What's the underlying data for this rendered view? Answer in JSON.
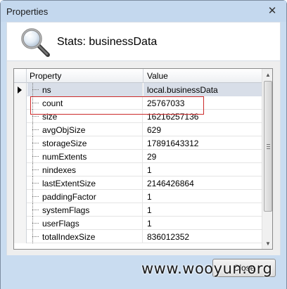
{
  "window": {
    "title": "Properties",
    "close_glyph": "✕"
  },
  "header": {
    "icon": "magnifier-icon",
    "title": "Stats: businessData"
  },
  "grid": {
    "columns": [
      "Property",
      "Value"
    ],
    "rows": [
      {
        "property": "ns",
        "value": "local.businessData",
        "selected": true
      },
      {
        "property": "count",
        "value": "25767033",
        "highlighted": true
      },
      {
        "property": "size",
        "value": "16216257136"
      },
      {
        "property": "avgObjSize",
        "value": "629"
      },
      {
        "property": "storageSize",
        "value": "17891643312"
      },
      {
        "property": "numExtents",
        "value": "29"
      },
      {
        "property": "nindexes",
        "value": "1"
      },
      {
        "property": "lastExtentSize",
        "value": "2146426864"
      },
      {
        "property": "paddingFactor",
        "value": "1"
      },
      {
        "property": "systemFlags",
        "value": "1"
      },
      {
        "property": "userFlags",
        "value": "1"
      },
      {
        "property": "totalIndexSize",
        "value": "836012352"
      }
    ],
    "highlight_color": "#cc2a2a"
  },
  "footer": {
    "close_label": "Close",
    "watermark": "www.wooyun.org"
  }
}
